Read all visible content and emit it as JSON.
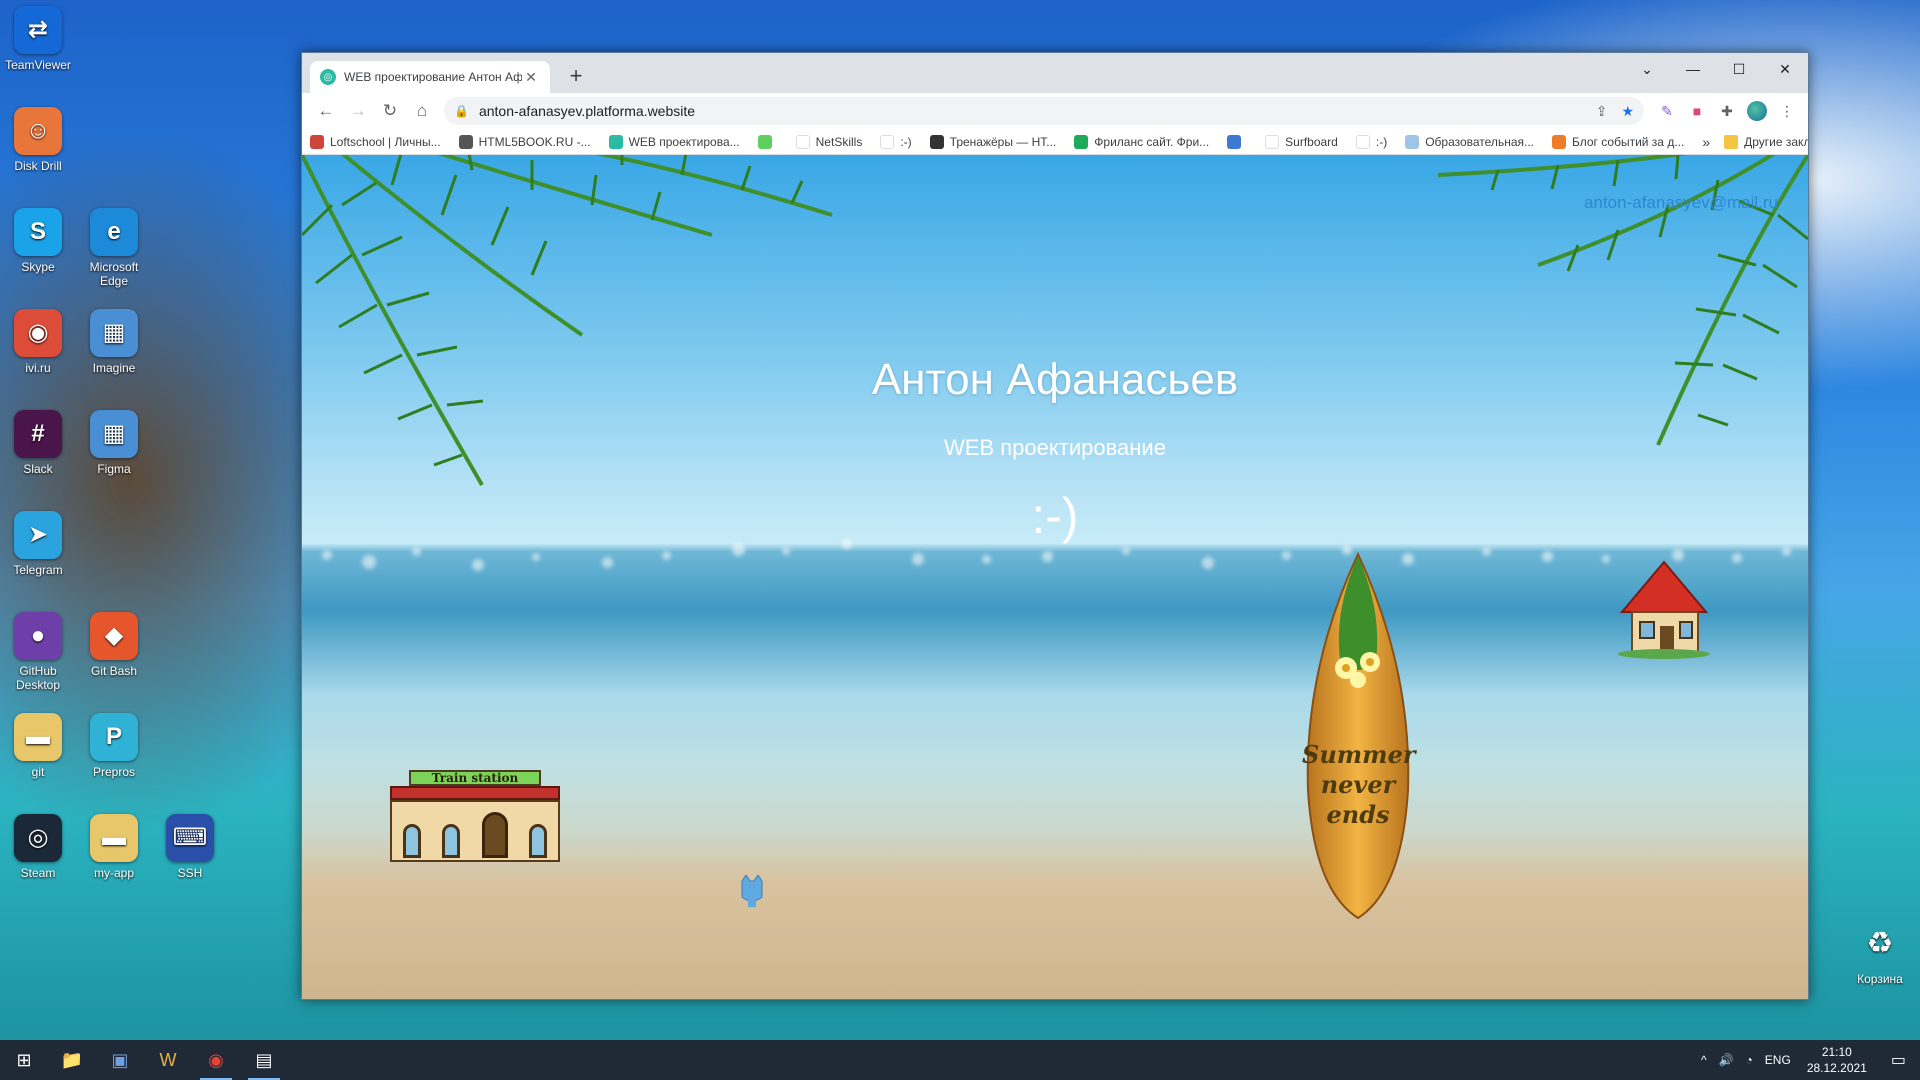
{
  "desktop": {
    "icons": [
      {
        "label": "TeamViewer",
        "glyph": "⇄",
        "color": "#1469d6"
      },
      {
        "label": "Disk Drill",
        "glyph": "☺",
        "color": "#e8763a"
      },
      {
        "label": "Skype",
        "glyph": "S",
        "color": "#1aa3e8"
      },
      {
        "label": "Microsoft Edge",
        "glyph": "e",
        "color": "#1c8ad8"
      },
      {
        "label": "ivi.ru",
        "glyph": "◉",
        "color": "#dd4b39"
      },
      {
        "label": "Imagine",
        "glyph": "▦",
        "color": "#4a8fd4"
      },
      {
        "label": "Slack",
        "glyph": "#",
        "color": "#4a154b"
      },
      {
        "label": "Figma",
        "glyph": "▦",
        "color": "#4a8fd4"
      },
      {
        "label": "Telegram",
        "glyph": "➤",
        "color": "#2aa3df"
      },
      {
        "label": "GitHub Desktop",
        "glyph": "●",
        "color": "#6e3fa8"
      },
      {
        "label": "Git Bash",
        "glyph": "◆",
        "color": "#e5562c"
      },
      {
        "label": "git",
        "glyph": "▬",
        "color": "#e8c66a"
      },
      {
        "label": "Prepros",
        "glyph": "P",
        "color": "#2fb2d6"
      },
      {
        "label": "Steam",
        "glyph": "◎",
        "color": "#1b2838"
      },
      {
        "label": "my-app",
        "glyph": "▬",
        "color": "#e8c66a"
      },
      {
        "label": "SSH",
        "glyph": "⌨",
        "color": "#2a4fa8"
      }
    ],
    "recycle_bin": {
      "label": "Корзина",
      "glyph": "♻"
    }
  },
  "browser": {
    "tab": {
      "title": "WEB проектирование Антон Аф",
      "close": "✕"
    },
    "new_tab": "+",
    "window_controls": {
      "collapse": "⌄",
      "minimize": "—",
      "maximize": "☐",
      "close": "✕"
    },
    "nav": {
      "back": "←",
      "forward": "→",
      "reload": "↻",
      "home": "⌂"
    },
    "address": {
      "lock": "🔒",
      "url": "anton-afanasyev.platforma.website"
    },
    "bookmarks": [
      {
        "label": "Loftschool | Личны...",
        "color": "#d0453a"
      },
      {
        "label": "HTML5BOOK.RU -...",
        "color": "#555555"
      },
      {
        "label": "WEB проектирова...",
        "color": "#2bbba4"
      },
      {
        "label": "",
        "color": "#5fcf5f"
      },
      {
        "label": "NetSkills",
        "color": "#ffffff"
      },
      {
        "label": ":-)",
        "color": "#ffffff"
      },
      {
        "label": "Тренажёры — HT...",
        "color": "#333333"
      },
      {
        "label": "Фриланс сайт. Фри...",
        "color": "#1faa59"
      },
      {
        "label": "",
        "color": "#3b7ad0"
      },
      {
        "label": "Surfboard",
        "color": "#ffffff"
      },
      {
        "label": ":-)",
        "color": "#ffffff"
      },
      {
        "label": "Образовательная...",
        "color": "#9fc4e8"
      },
      {
        "label": "Блог событий за д...",
        "color": "#f07c2a"
      }
    ],
    "bookmarks_more": "»",
    "other_bookmarks": "Другие закладки"
  },
  "site": {
    "email": "anton-afanasyev@mail.ru",
    "title": "Антон Афанасьев",
    "subtitle": "WEB проектирование",
    "smile": ":-)",
    "station_sign": "Train station",
    "surfboard_text": [
      "Summer",
      "never",
      "ends"
    ]
  },
  "taskbar": {
    "start": "⊞",
    "apps": [
      "📁",
      "▣",
      "W",
      "◉",
      "▤"
    ],
    "tray_chevron": "^",
    "lang": "ENG",
    "time": "21:10",
    "date": "28.12.2021",
    "notif": "▭"
  }
}
